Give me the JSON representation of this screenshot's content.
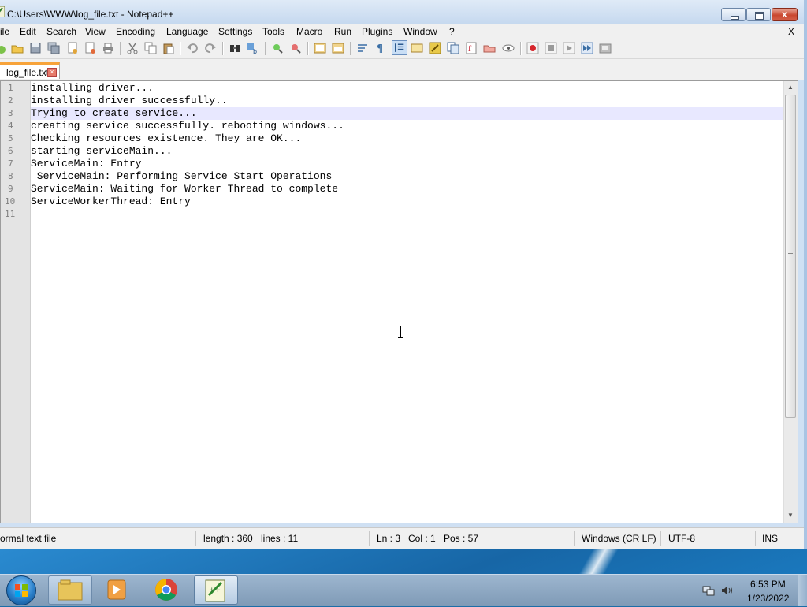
{
  "window": {
    "title": "C:\\Users\\WWW\\log_file.txt - Notepad++",
    "close_glyph": "x"
  },
  "menu": {
    "items": [
      "ile",
      "Edit",
      "Search",
      "View",
      "Encoding",
      "Language",
      "Settings",
      "Tools",
      "Macro",
      "Run",
      "Plugins",
      "Window",
      "?"
    ],
    "close": "X"
  },
  "tab": {
    "label": "log_file.txt"
  },
  "editor": {
    "lines": [
      "installing driver...",
      "installing driver successfully..",
      "Trying to create service...",
      "creating service successfully. rebooting windows...",
      "Checking resources existence. They are OK...",
      "starting serviceMain...",
      "ServiceMain: Entry",
      " ServiceMain: Performing Service Start Operations",
      "ServiceMain: Waiting for Worker Thread to complete",
      "ServiceWorkerThread: Entry",
      ""
    ],
    "line_numbers": [
      "1",
      "2",
      "3",
      "4",
      "5",
      "6",
      "7",
      "8",
      "9",
      "10",
      "11"
    ],
    "current_line": 3
  },
  "status": {
    "file_type": "ormal text file",
    "length": "length : 360",
    "lines": "lines : 11",
    "ln": "Ln : 3",
    "col": "Col : 1",
    "pos": "Pos : 57",
    "eol": "Windows (CR LF)",
    "encoding": "UTF-8",
    "mode": "INS"
  },
  "taskbar": {
    "time": "6:53 PM",
    "date": "1/23/2022"
  },
  "colors": {
    "current_line_bg": "#e8e8ff",
    "tab_accent": "#f7a33a",
    "taskbar": "#8aa5c1"
  }
}
